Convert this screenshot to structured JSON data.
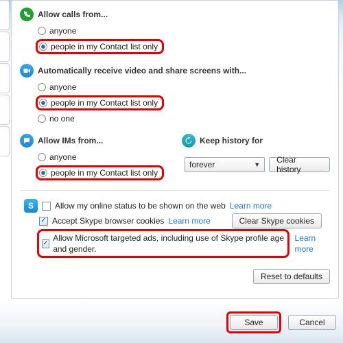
{
  "sections": {
    "calls": {
      "title": "Allow calls from...",
      "options": {
        "anyone": "anyone",
        "contacts": "people in my Contact list only"
      }
    },
    "video": {
      "title": "Automatically receive video and share screens with...",
      "options": {
        "anyone": "anyone",
        "contacts": "people in my Contact list only",
        "noone": "no one"
      }
    },
    "ims": {
      "title": "Allow IMs from...",
      "options": {
        "anyone": "anyone",
        "contacts": "people in my Contact list only"
      }
    },
    "history": {
      "title": "Keep history for",
      "select_value": "forever",
      "clear_button": "Clear history"
    }
  },
  "checks": {
    "status_web": "Allow my online status to be shown on the web",
    "cookies": "Accept Skype browser cookies",
    "ads": "Allow Microsoft targeted ads, including use of Skype profile age and gender.",
    "learn_more": "Learn more",
    "clear_cookies": "Clear Skype cookies"
  },
  "buttons": {
    "reset": "Reset to defaults",
    "save": "Save",
    "cancel": "Cancel"
  }
}
